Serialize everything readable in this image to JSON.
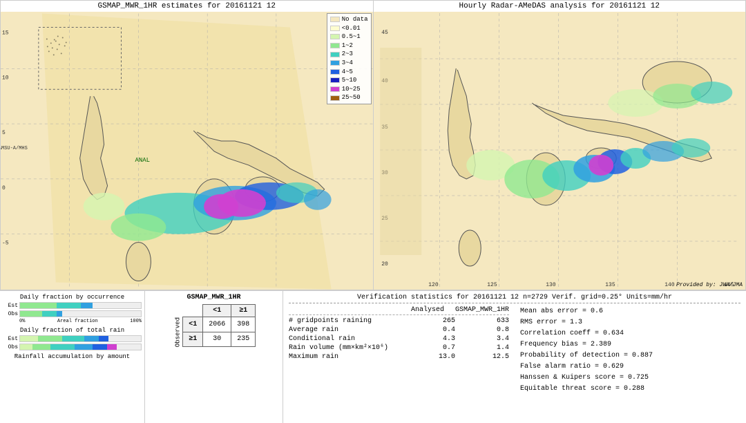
{
  "maps": {
    "left_title": "GSMAP_MWR_1HR estimates for 20161121 12",
    "right_title": "Hourly Radar-AMeDAS analysis for 20161121 12",
    "left_y_label": "MetOp-A/AMSU-A/MHS",
    "left_anal_label": "ANAL",
    "right_provided": "Provided by: JWA/JMA"
  },
  "legend": {
    "items": [
      {
        "label": "No data",
        "color": "#f5e8c0"
      },
      {
        "label": "<0.01",
        "color": "#fffdd0"
      },
      {
        "label": "0.5~1",
        "color": "#d4f5b0"
      },
      {
        "label": "1~2",
        "color": "#90e890"
      },
      {
        "label": "2~3",
        "color": "#40d0c0"
      },
      {
        "label": "3~4",
        "color": "#30a0e0"
      },
      {
        "label": "4~5",
        "color": "#2060e0"
      },
      {
        "label": "5~10",
        "color": "#1820c0"
      },
      {
        "label": "10~25",
        "color": "#d040d0"
      },
      {
        "label": "25~50",
        "color": "#a06010"
      }
    ]
  },
  "charts": {
    "occurrence_title": "Daily fraction by occurrence",
    "rain_title": "Daily fraction of total rain",
    "accumulation_title": "Rainfall accumulation by amount",
    "est_label": "Est",
    "obs_label": "Obs",
    "axis_left": "0%",
    "axis_right": "100%",
    "axis_mid": "Areal fraction"
  },
  "contingency": {
    "title": "GSMAP_MWR_1HR",
    "col_less": "<1",
    "col_ge": "≥1",
    "row_less": "<1",
    "row_ge": "≥1",
    "obs_label": "O\nb\ns\ne\nr\nv\ne\nd",
    "values": {
      "ll": "2066",
      "lg": "398",
      "gl": "30",
      "gg": "235"
    }
  },
  "verification": {
    "title": "Verification statistics for 20161121 12  n=2729  Verif. grid=0.25°  Units=mm/hr",
    "col_analysed": "Analysed",
    "col_gsmap": "GSMAP_MWR_1HR",
    "rows": [
      {
        "name": "# gridpoints raining",
        "analysed": "265",
        "gsmap": "633"
      },
      {
        "name": "Average rain",
        "analysed": "0.4",
        "gsmap": "0.8"
      },
      {
        "name": "Conditional rain",
        "analysed": "4.3",
        "gsmap": "3.4"
      },
      {
        "name": "Rain volume (mm×km²×10⁶)",
        "analysed": "0.7",
        "gsmap": "1.4"
      },
      {
        "name": "Maximum rain",
        "analysed": "13.0",
        "gsmap": "12.5"
      }
    ],
    "metrics": [
      {
        "label": "Mean abs error = 0.6"
      },
      {
        "label": "RMS error = 1.3"
      },
      {
        "label": "Correlation coeff = 0.634"
      },
      {
        "label": "Frequency bias = 2.389"
      },
      {
        "label": "Probability of detection = 0.887"
      },
      {
        "label": "False alarm ratio = 0.629"
      },
      {
        "label": "Hanssen & Kuipers score = 0.725"
      },
      {
        "label": "Equitable threat score = 0.288"
      }
    ]
  }
}
